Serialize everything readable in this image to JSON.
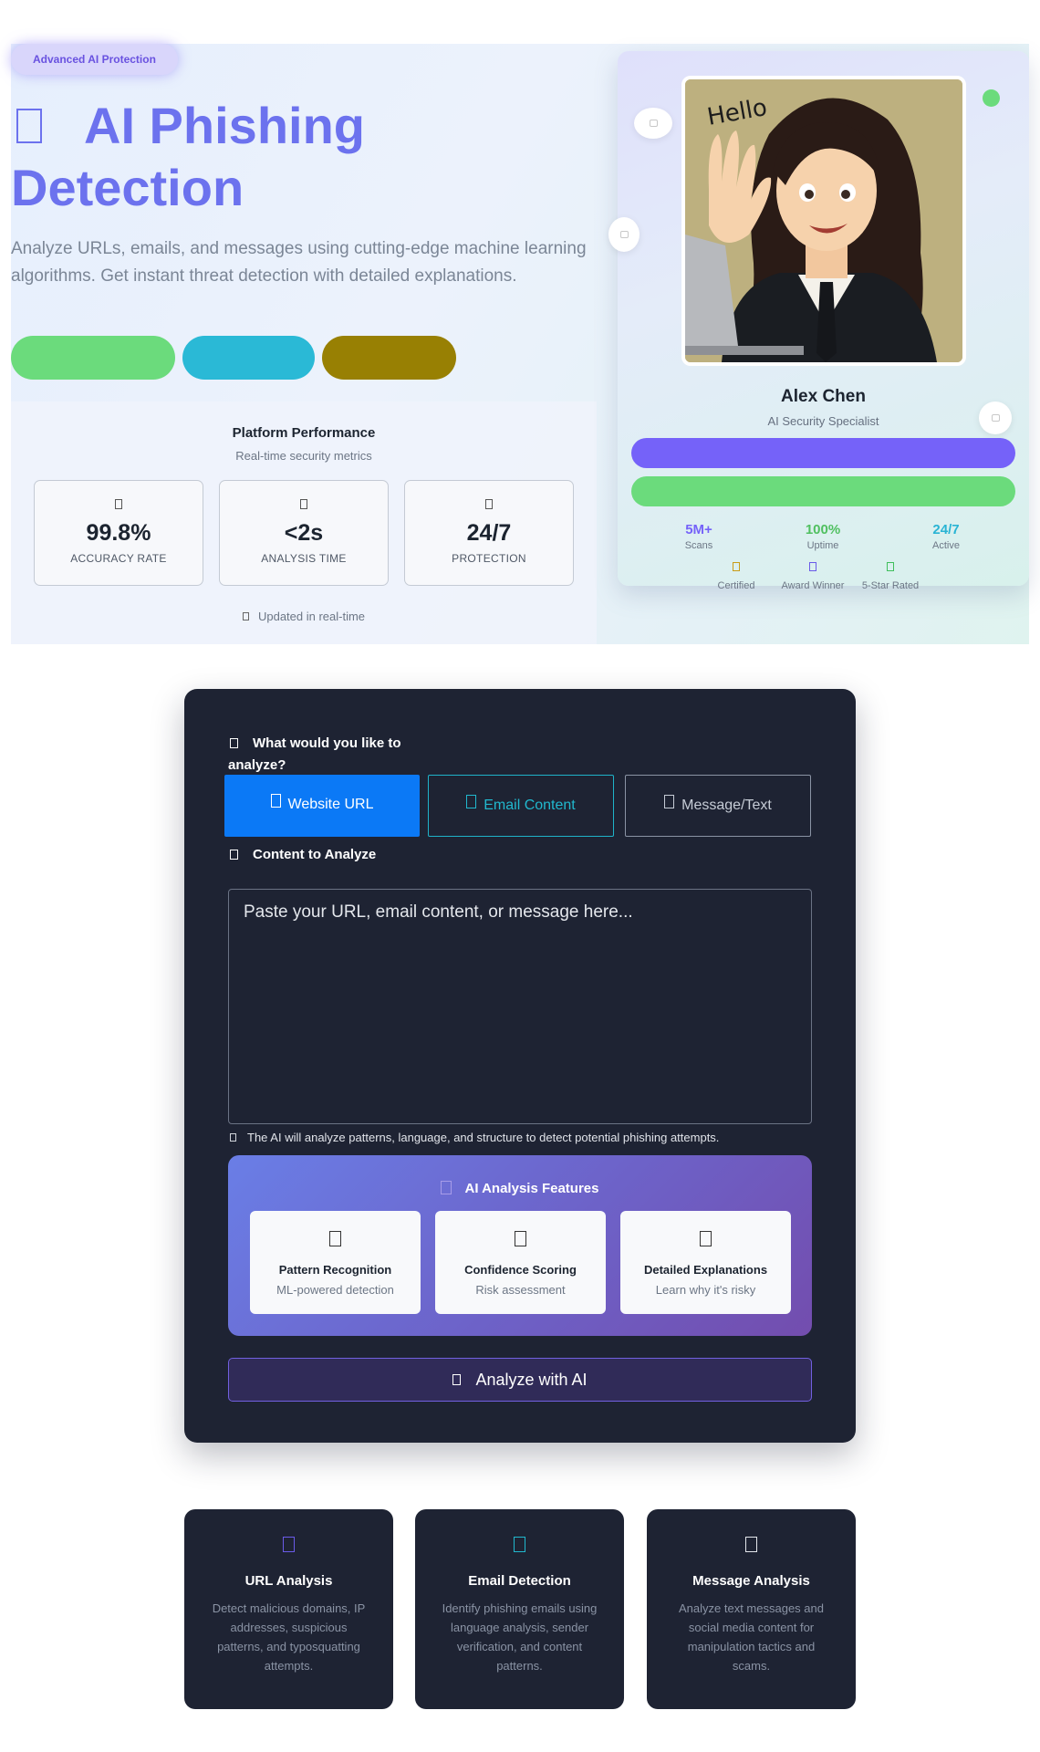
{
  "hero": {
    "badge": "Advanced AI Protection",
    "title": "AI Phishing Detection",
    "description": "Analyze URLs, emails, and messages using cutting-edge machine learning algorithms. Get instant threat detection with detailed explanations.",
    "accent_color": "#6c72ee",
    "pill_colors": [
      "#6bdb7c",
      "#2ab9d6",
      "#988003"
    ]
  },
  "performance": {
    "title": "Platform Performance",
    "subtitle": "Real-time security metrics",
    "stats": [
      {
        "value": "99.8%",
        "label": "ACCURACY RATE"
      },
      {
        "value": "<2s",
        "label": "ANALYSIS TIME"
      },
      {
        "value": "24/7",
        "label": "PROTECTION"
      }
    ],
    "updated": "Updated in real-time"
  },
  "profile": {
    "name": "Alex Chen",
    "role": "AI Security Specialist",
    "avatar_caption": "Hello",
    "stats": [
      {
        "value": "5M+",
        "label": "Scans"
      },
      {
        "value": "100%",
        "label": "Uptime"
      },
      {
        "value": "24/7",
        "label": "Active"
      }
    ],
    "trust": [
      {
        "label": "Certified",
        "icon": "certificate-icon"
      },
      {
        "label": "Award Winner",
        "icon": "award-icon"
      },
      {
        "label": "5-Star Rated",
        "icon": "star-icon"
      }
    ]
  },
  "form": {
    "question": "What would you like to analyze?",
    "types": [
      {
        "label": "Website URL",
        "icon": "globe-icon"
      },
      {
        "label": "Email Content",
        "icon": "envelope-icon"
      },
      {
        "label": "Message/Text",
        "icon": "message-icon"
      }
    ],
    "content_label": "Content to Analyze",
    "placeholder": "Paste your URL, email content, or message here...",
    "hint": "The AI will analyze patterns, language, and structure to detect potential phishing attempts.",
    "features_title": "AI Analysis Features",
    "features": [
      {
        "title": "Pattern Recognition",
        "subtitle": "ML-powered detection"
      },
      {
        "title": "Confidence Scoring",
        "subtitle": "Risk assessment"
      },
      {
        "title": "Detailed Explanations",
        "subtitle": "Learn why it's risky"
      }
    ],
    "analyze_label": "Analyze with AI"
  },
  "info_cards": [
    {
      "title": "URL Analysis",
      "description": "Detect malicious domains, IP addresses, suspicious patterns, and typosquatting attempts."
    },
    {
      "title": "Email Detection",
      "description": "Identify phishing emails using language analysis, sender verification, and content patterns."
    },
    {
      "title": "Message Analysis",
      "description": "Analyze text messages and social media content for manipulation tactics and scams."
    }
  ]
}
